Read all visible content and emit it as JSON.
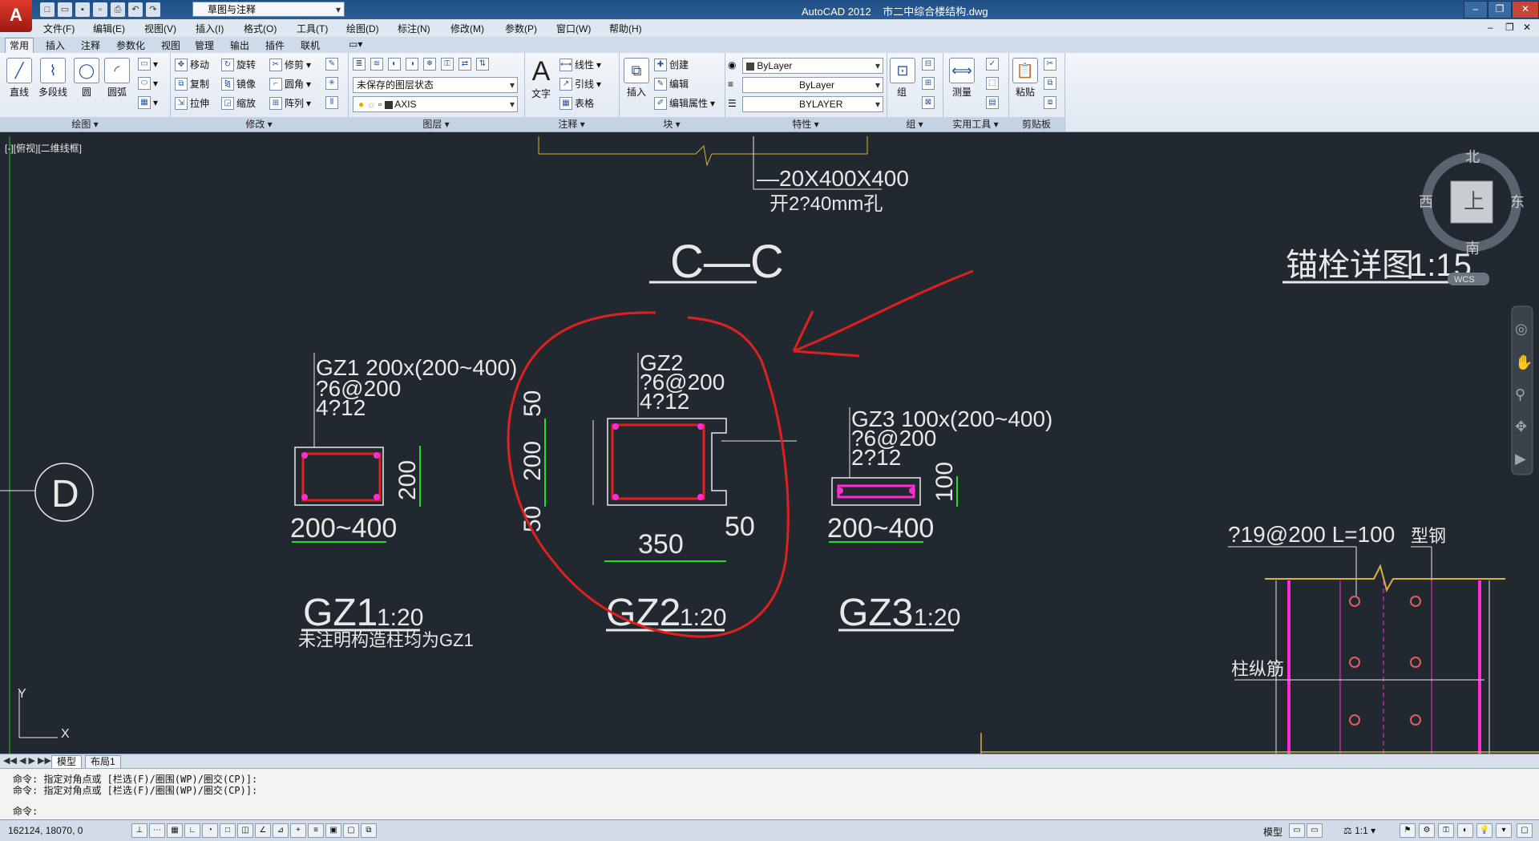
{
  "title": {
    "app": "AutoCAD 2012",
    "file": "市二中综合楼结构.dwg",
    "workspace": "草图与注释"
  },
  "menu": [
    "文件(F)",
    "编辑(E)",
    "视图(V)",
    "插入(I)",
    "格式(O)",
    "工具(T)",
    "绘图(D)",
    "标注(N)",
    "修改(M)",
    "参数(P)",
    "窗口(W)",
    "帮助(H)"
  ],
  "ribbon_tabs": [
    "常用",
    "插入",
    "注释",
    "参数化",
    "视图",
    "管理",
    "输出",
    "插件",
    "联机"
  ],
  "ribbon": {
    "draw": {
      "title": "绘图",
      "line": "直线",
      "polyline": "多段线",
      "circle": "圆",
      "arc": "圆弧"
    },
    "modify": {
      "title": "修改",
      "move": "移动",
      "rotate": "旋转",
      "trim": "修剪",
      "copy": "复制",
      "mirror": "镜像",
      "fillet": "圆角",
      "stretch": "拉伸",
      "scale": "缩放",
      "array": "阵列"
    },
    "layers": {
      "title": "图层",
      "state": "未保存的图层状态",
      "current": "AXIS"
    },
    "annotation": {
      "title": "注释",
      "text": "文字",
      "linear": "线性",
      "leader": "引线",
      "table": "表格"
    },
    "block": {
      "title": "块",
      "insert": "插入",
      "create": "创建",
      "edit": "编辑",
      "edit_attr": "编辑属性"
    },
    "properties": {
      "title": "特性",
      "color": "ByLayer",
      "linetype": "ByLayer",
      "lineweight": "BYLAYER"
    },
    "groups": {
      "title": "组",
      "group": "组"
    },
    "utilities": {
      "title": "实用工具",
      "measure": "测量"
    },
    "clipboard": {
      "title": "剪贴板",
      "paste": "粘贴"
    }
  },
  "viewport_label": "[-][俯视][二维线框]",
  "viewcube": {
    "north": "北",
    "south": "南",
    "east": "东",
    "west": "西",
    "top": "上",
    "wcs": "WCS"
  },
  "drawing": {
    "section_title": "C—C",
    "plate": "—20X400X400",
    "hole": "开2?40mm孔",
    "anchor_title": "锚栓详图",
    "anchor_scale": "1:15",
    "axis_label": "D",
    "gz1": {
      "l1": "GZ1 200x(200~400)",
      "l2": "?6@200",
      "l3": "4?12",
      "dim_w": "200~400",
      "dim_h": "200",
      "name": "GZ1",
      "scale": "1:20",
      "note": "未注明构造柱均为GZ1"
    },
    "gz2": {
      "l1": "GZ2",
      "l2": "?6@200",
      "l3": "4?12",
      "dim_w": "350",
      "dim_r": "50",
      "dim_top": "50",
      "dim_mid": "200",
      "dim_bot": "50",
      "name": "GZ2",
      "scale": "1:20"
    },
    "gz3": {
      "l1": "GZ3 100x(200~400)",
      "l2": "?6@200",
      "l3": "2?12",
      "dim_w": "200~400",
      "dim_h": "100",
      "name": "GZ3",
      "scale": "1:20"
    },
    "anchor": {
      "rebar": "?19@200 L=100",
      "steel": "型钢",
      "column_rebar": "柱纵筋"
    },
    "ucs": {
      "x": "X",
      "y": "Y"
    }
  },
  "layout_tabs": [
    "模型",
    "布局1"
  ],
  "command_lines": [
    "命令: 指定对角点或 [栏选(F)/圈围(WP)/圈交(CP)]:",
    "命令: 指定对角点或 [栏选(F)/圈围(WP)/圈交(CP)]:",
    "命令:"
  ],
  "status": {
    "coords": "162124, 18070, 0",
    "model": "模型",
    "scale": "1:1"
  },
  "colors": {
    "background": "#212830",
    "red_annotation": "#e0201c",
    "green_dim": "#22dd22",
    "magenta": "#ff2bd6",
    "yellow": "#d9b23a"
  }
}
